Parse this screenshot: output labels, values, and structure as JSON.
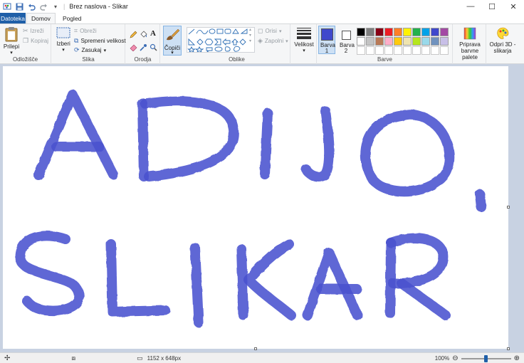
{
  "window": {
    "title": "Brez naslova - Slikar",
    "minimize": "—",
    "maximize": "☐",
    "close": "✕"
  },
  "tabs": {
    "file": "Datoteka",
    "home": "Domov",
    "view": "Pogled"
  },
  "ribbon": {
    "clipboard": {
      "label": "Odložišče",
      "paste": "Prilepi",
      "cut": "Izreži",
      "copy": "Kopiraj"
    },
    "image": {
      "label": "Slika",
      "select": "Izberi",
      "crop": "Obreži",
      "resize": "Spremeni velikost",
      "rotate": "Zasukaj"
    },
    "tools": {
      "label": "Orodja"
    },
    "brushes": {
      "label": "Čopiči"
    },
    "shapes": {
      "label": "Oblike",
      "outline": "Orisi",
      "fill": "Zapolni"
    },
    "size": {
      "label": "Velikost"
    },
    "color1": {
      "label": "Barva 1",
      "value": "#3f48cc"
    },
    "color2": {
      "label": "Barva 2",
      "value": "#ffffff"
    },
    "colors": {
      "label": "Barve",
      "palette": [
        "#000000",
        "#7f7f7f",
        "#880015",
        "#ed1c24",
        "#ff7f27",
        "#fff200",
        "#22b14c",
        "#00a2e8",
        "#3f48cc",
        "#a349a4",
        "#ffffff",
        "#c3c3c3",
        "#b97a57",
        "#ffaec9",
        "#ffc90e",
        "#efe4b0",
        "#b5e61d",
        "#99d9ea",
        "#7092be",
        "#c8bfe7",
        "#ffffff",
        "#ffffff",
        "#ffffff",
        "#ffffff",
        "#ffffff",
        "#ffffff",
        "#ffffff",
        "#ffffff",
        "#ffffff",
        "#ffffff"
      ]
    },
    "edit_colors": "Priprava barvne palete",
    "open3d": "Odpri 3D -slikarja"
  },
  "canvas": {
    "drawing": {
      "line1": "ADIJO,",
      "line2": "SLIKAR",
      "stroke_color": "#3f48cc"
    }
  },
  "status": {
    "dimensions": "1152 x 648px",
    "zoom": "100%",
    "zoom_level_fraction": 0.5
  }
}
